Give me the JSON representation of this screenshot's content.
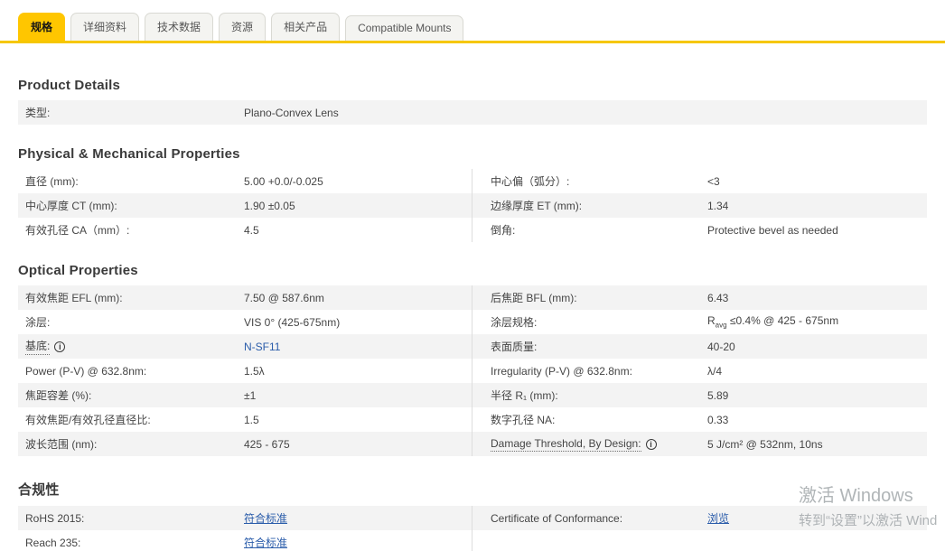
{
  "colors": {
    "accent_yellow": "#ffc600",
    "link_blue": "#2a5caa",
    "row_gray": "#f3f3f3"
  },
  "tabs": [
    {
      "label": "规格",
      "active": true
    },
    {
      "label": "详细资料",
      "active": false
    },
    {
      "label": "技术数据",
      "active": false
    },
    {
      "label": "资源",
      "active": false
    },
    {
      "label": "相关产品",
      "active": false
    },
    {
      "label": "Compatible Mounts",
      "active": false
    }
  ],
  "sections": {
    "product_details": {
      "title": "Product Details",
      "rows": [
        {
          "label": "类型:",
          "value": "Plano-Convex Lens"
        }
      ]
    },
    "physical": {
      "title": "Physical & Mechanical Properties",
      "left": [
        {
          "label": "直径 (mm):",
          "value": "5.00 +0.0/-0.025"
        },
        {
          "label": "中心厚度 CT (mm):",
          "value": "1.90 ±0.05"
        },
        {
          "label": "有效孔径 CA（mm）:",
          "value": "4.5"
        }
      ],
      "right": [
        {
          "label": "中心偏（弧分）:",
          "value": "<3"
        },
        {
          "label": "边缘厚度 ET (mm):",
          "value": "1.34"
        },
        {
          "label": "倒角:",
          "value": "Protective bevel as needed"
        }
      ]
    },
    "optical": {
      "title": "Optical Properties",
      "left": [
        {
          "label": "有效焦距 EFL (mm):",
          "value": "7.50 @ 587.6nm"
        },
        {
          "label": "涂层:",
          "value": "VIS 0° (425-675nm)"
        },
        {
          "label": "基底:",
          "value": "N-SF11"
        },
        {
          "label": "Power (P-V) @ 632.8nm:",
          "value": "1.5λ"
        },
        {
          "label": "焦距容差 (%):",
          "value": "±1"
        },
        {
          "label": "有效焦距/有效孔径直径比:",
          "value": "1.5"
        },
        {
          "label": "波长范围 (nm):",
          "value": "425 - 675"
        }
      ],
      "right": [
        {
          "label": "后焦距 BFL (mm):",
          "value": "6.43"
        },
        {
          "label": "涂层规格:",
          "value_base": "R",
          "value_sub": "avg",
          "value_rest": " ≤0.4% @ 425 - 675nm"
        },
        {
          "label": "表面质量:",
          "value": "40-20"
        },
        {
          "label": "Irregularity (P-V) @ 632.8nm:",
          "value": "λ/4"
        },
        {
          "label": "半径 R₁ (mm):",
          "value": "5.89"
        },
        {
          "label": "数字孔径 NA:",
          "value": "0.33"
        },
        {
          "label": "Damage Threshold, By Design:",
          "value": "5 J/cm² @ 532nm, 10ns"
        }
      ]
    },
    "compliance": {
      "title": "合规性",
      "left": [
        {
          "label": "RoHS 2015:",
          "value": "符合标准"
        },
        {
          "label": "Reach 235:",
          "value": "符合标准"
        }
      ],
      "right": [
        {
          "label": "Certificate of Conformance:",
          "value": "浏览"
        }
      ]
    }
  },
  "watermark": {
    "line1": "激活 Windows",
    "line2": "转到“设置”以激活 Wind"
  }
}
